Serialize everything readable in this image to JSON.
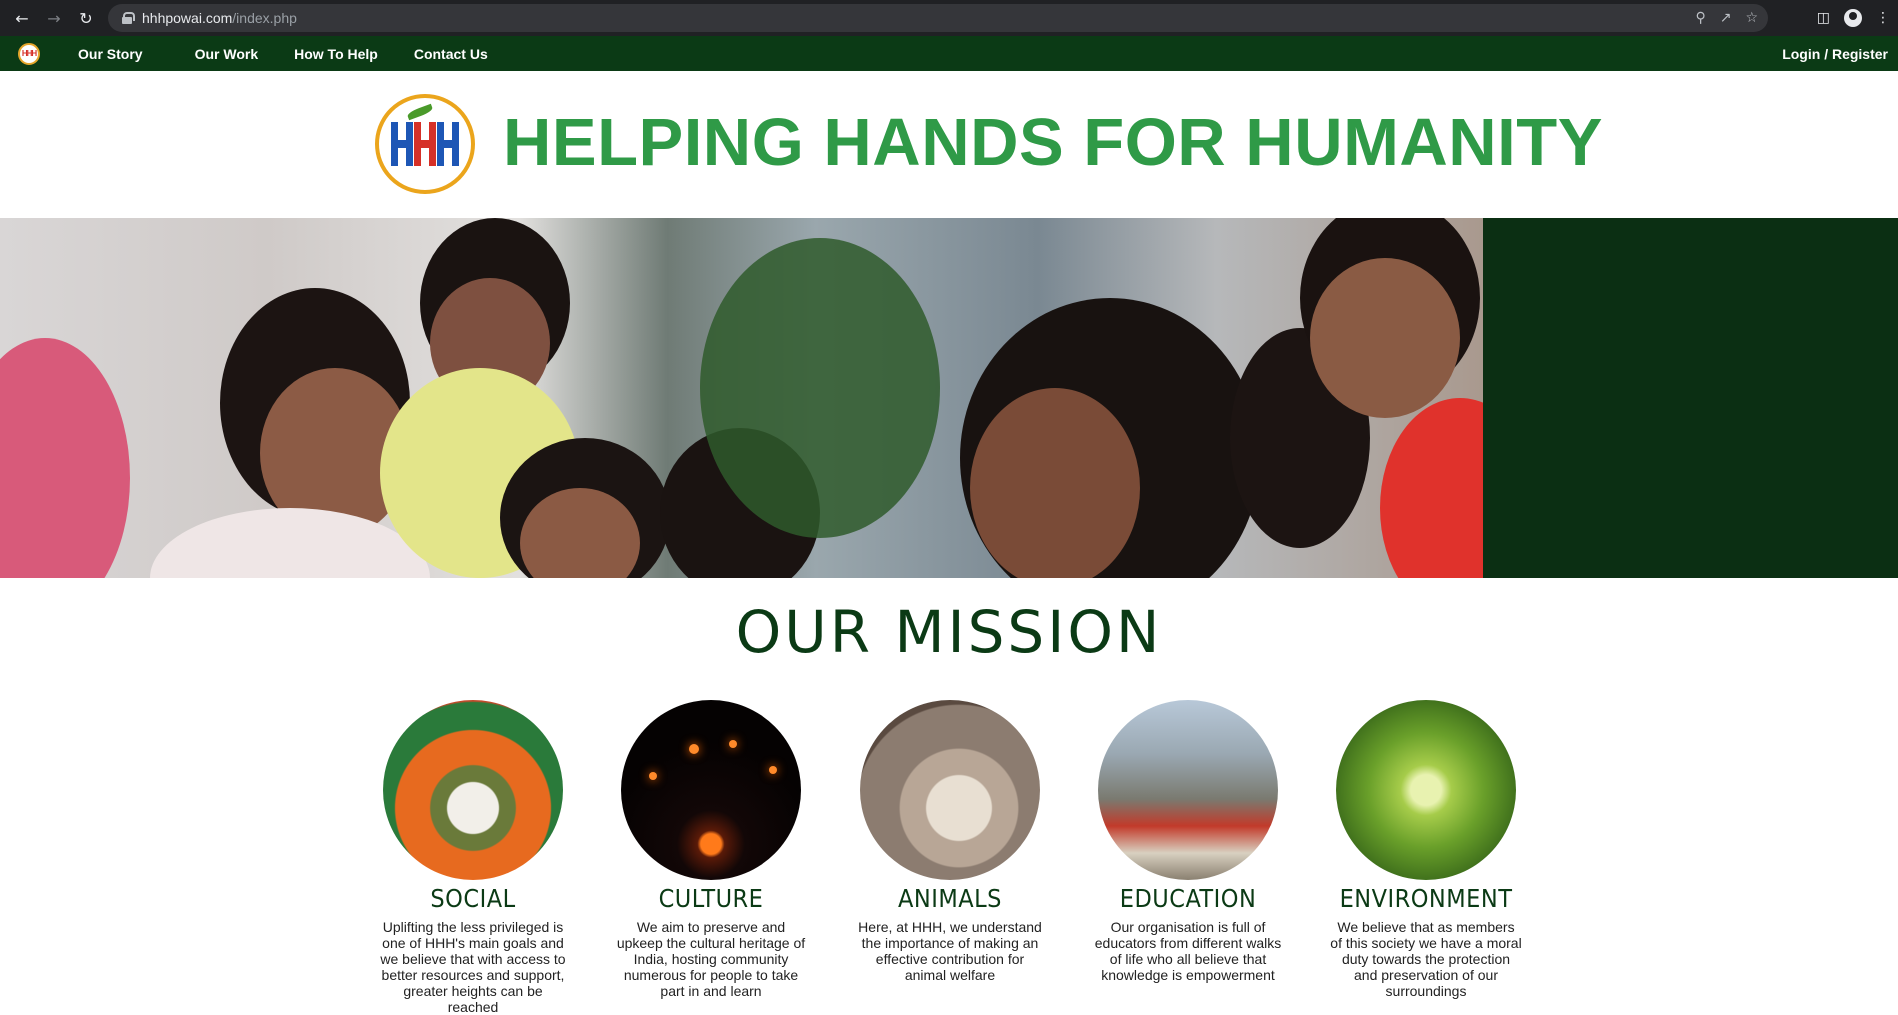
{
  "browser": {
    "url_host": "hhhpowai.com",
    "url_path": "/index.php"
  },
  "nav": {
    "links": [
      "Our Story",
      "Our Work",
      "How To Help",
      "Contact Us"
    ],
    "login": "Login / Register",
    "logo_text": "HHH"
  },
  "header": {
    "title": "HELPING HANDS FOR HUMANITY"
  },
  "mission": {
    "title": "OUR MISSION",
    "cards": [
      {
        "title": "SOCIAL",
        "text": "Uplifting the less privileged is one of HHH's main goals and we believe that with access to better resources and support, greater heights can be reached"
      },
      {
        "title": "CULTURE",
        "text": "We aim to preserve and upkeep the cultural heritage of India, hosting community numerous for people to take part in and learn"
      },
      {
        "title": "ANIMALS",
        "text": "Here, at HHH, we understand the importance of making an effective contribution for animal welfare"
      },
      {
        "title": "EDUCATION",
        "text": "Our organisation is full of educators from different walks of life who all believe that knowledge is empowerment"
      },
      {
        "title": "ENVIRONMENT",
        "text": "We believe that as members of this society we have a moral duty towards the protection and preservation of our surroundings"
      }
    ]
  },
  "colors": {
    "nav_bg": "#0b3a15",
    "title_green": "#2f9a47",
    "mission_green": "#0b3a15"
  }
}
